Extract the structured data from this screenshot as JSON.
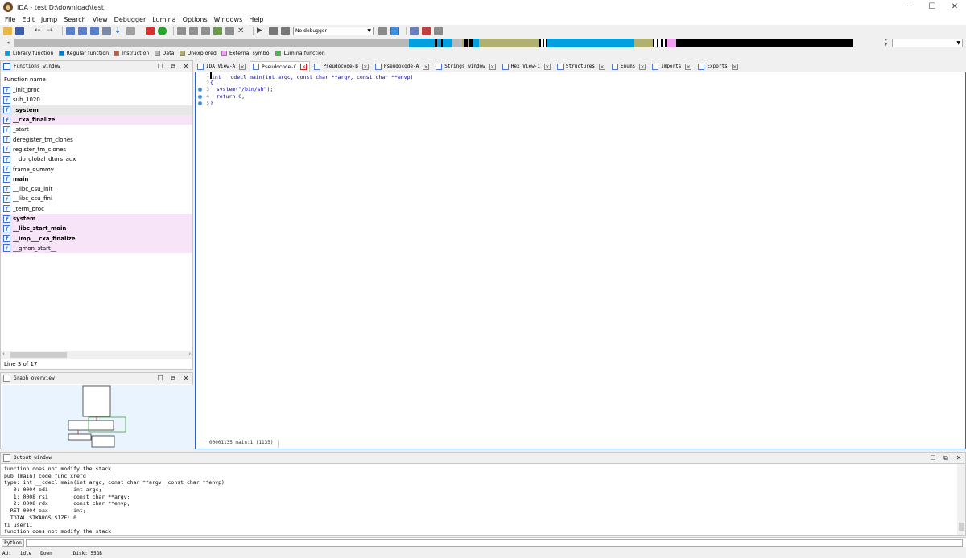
{
  "window": {
    "title": "IDA - test D:\\download\\test",
    "minimize": "─",
    "maximize": "☐",
    "close": "✕"
  },
  "menu": [
    "File",
    "Edit",
    "Jump",
    "Search",
    "View",
    "Debugger",
    "Lumina",
    "Options",
    "Windows",
    "Help"
  ],
  "toolbar": {
    "debugger_select": "No debugger"
  },
  "legend": [
    {
      "label": "Library function",
      "color": "#00a0e0"
    },
    {
      "label": "Regular function",
      "color": "#0078c8"
    },
    {
      "label": "Instruction",
      "color": "#b06048"
    },
    {
      "label": "Data",
      "color": "#b8b8b8"
    },
    {
      "label": "Unexplored",
      "color": "#b0b070"
    },
    {
      "label": "External symbol",
      "color": "#f0a0f0"
    },
    {
      "label": "Lumina function",
      "color": "#40c040"
    }
  ],
  "functions": {
    "title": "Functions window",
    "column": "Function name",
    "items": [
      {
        "name": "_init_proc",
        "style": "normal"
      },
      {
        "name": "sub_1020",
        "style": "normal"
      },
      {
        "name": "_system",
        "style": "sel"
      },
      {
        "name": "__cxa_finalize",
        "style": "pink"
      },
      {
        "name": "_start",
        "style": "normal"
      },
      {
        "name": "deregister_tm_clones",
        "style": "normal"
      },
      {
        "name": "register_tm_clones",
        "style": "normal"
      },
      {
        "name": "__do_global_dtors_aux",
        "style": "normal"
      },
      {
        "name": "frame_dummy",
        "style": "normal"
      },
      {
        "name": "main",
        "style": "boldonly"
      },
      {
        "name": "__libc_csu_init",
        "style": "normal"
      },
      {
        "name": "__libc_csu_fini",
        "style": "normal"
      },
      {
        "name": "_term_proc",
        "style": "normal"
      },
      {
        "name": "system",
        "style": "pink"
      },
      {
        "name": "__libc_start_main",
        "style": "pink"
      },
      {
        "name": "__imp___cxa_finalize",
        "style": "pink"
      },
      {
        "name": "__gmon_start__",
        "style": "pinklight"
      }
    ],
    "status": "Line 3 of 17"
  },
  "graph": {
    "title": "Graph overview"
  },
  "tabs": [
    {
      "label": "IDA View-A",
      "active": false
    },
    {
      "label": "Pseudocode-C",
      "active": true
    },
    {
      "label": "Pseudocode-B",
      "active": false
    },
    {
      "label": "Pseudocode-A",
      "active": false
    },
    {
      "label": "Strings window",
      "active": false
    },
    {
      "label": "Hex View-1",
      "active": false
    },
    {
      "label": "Structures",
      "active": false
    },
    {
      "label": "Enums",
      "active": false
    },
    {
      "label": "Imports",
      "active": false
    },
    {
      "label": "Exports",
      "active": false
    }
  ],
  "code": {
    "line_numbers": [
      "1",
      "2",
      "3",
      "4",
      "5"
    ],
    "lines": [
      "int __cdecl main(int argc, const char **argv, const char **envp)",
      "{",
      "  system(\"/bin/sh\");",
      "  return 0;",
      "}"
    ],
    "status": "00001135 main:1 (1135)"
  },
  "output": {
    "title": "Output window",
    "lines": [
      "function does not modify the stack",
      "pub [main] code func xrefd",
      "type: int __cdecl main(int argc, const char **argv, const char **envp)",
      "   0: 0004 edi        int argc;",
      "   1: 0008 rsi        const char **argv;",
      "   2: 0008 rdx        const char **envp;",
      "  RET 0004 eax        int;",
      "  TOTAL STKARGS SIZE: 0",
      "ti user11",
      "function does not modify the stack"
    ]
  },
  "python": {
    "label": "Python"
  },
  "status": {
    "au": "AU:",
    "state": "idle",
    "dir": "Down",
    "disk": "Disk: 55GB"
  }
}
